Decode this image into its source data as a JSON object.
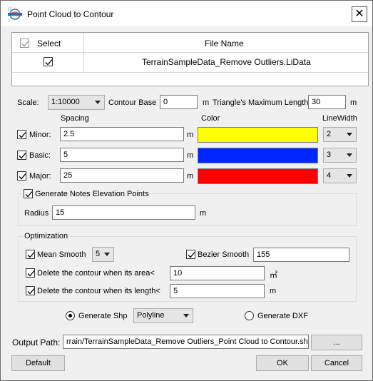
{
  "window": {
    "title": "Point Cloud to Contour",
    "close_glyph": "✕"
  },
  "table": {
    "headers": {
      "select": "Select",
      "file_name": "File Name"
    },
    "rows": [
      {
        "checked": true,
        "file_name": "TerrainSampleData_Remove Outliers.LiData"
      }
    ]
  },
  "params": {
    "scale_label": "Scale:",
    "scale_value": "1:10000",
    "contour_base_label": "Contour Base",
    "contour_base_value": "0",
    "contour_base_unit": "m",
    "triangle_label": "Triangle's Maximum Length",
    "triangle_value": "30",
    "triangle_unit": "m"
  },
  "columns": {
    "spacing": "Spacing",
    "color": "Color",
    "line_width": "LineWidth"
  },
  "contours": [
    {
      "label": "Minor:",
      "checked": true,
      "spacing": "2.5",
      "unit": "m",
      "color": "#ffff00",
      "line_width": "2"
    },
    {
      "label": "Basic:",
      "checked": true,
      "spacing": "5",
      "unit": "m",
      "color": "#0026ff",
      "line_width": "3"
    },
    {
      "label": "Major:",
      "checked": true,
      "spacing": "25",
      "unit": "m",
      "color": "#ff0000",
      "line_width": "4"
    }
  ],
  "notes": {
    "label": "Generate Notes Elevation Points",
    "checked": true,
    "radius_label": "Radius",
    "radius_value": "15",
    "radius_unit": "m"
  },
  "optimization": {
    "title": "Optimization",
    "mean_smooth_label": "Mean Smooth",
    "mean_smooth_checked": true,
    "mean_smooth_value": "5",
    "bezier_label": "Bezier Smooth",
    "bezier_checked": true,
    "bezier_value": "155",
    "area_label": "Delete the contour when its area<",
    "area_checked": true,
    "area_value": "10",
    "area_unit": "㎡",
    "length_label": "Delete the contour when its length<",
    "length_checked": true,
    "length_value": "5",
    "length_unit": "m"
  },
  "output_mode": {
    "shp_label": "Generate Shp",
    "shp_selected": true,
    "shp_type": "Polyline",
    "dxf_label": "Generate DXF",
    "dxf_selected": false
  },
  "output": {
    "label": "Output Path:",
    "value": "rrain/TerrainSampleData_Remove Outliers_Point Cloud to Contour.shp",
    "browse_label": "..."
  },
  "buttons": {
    "default": "Default",
    "ok": "OK",
    "cancel": "Cancel"
  },
  "icons": {
    "app": "lidar360-logo-icon",
    "close": "close-icon",
    "check": "check-icon",
    "dropdown": "chevron-down-icon"
  }
}
